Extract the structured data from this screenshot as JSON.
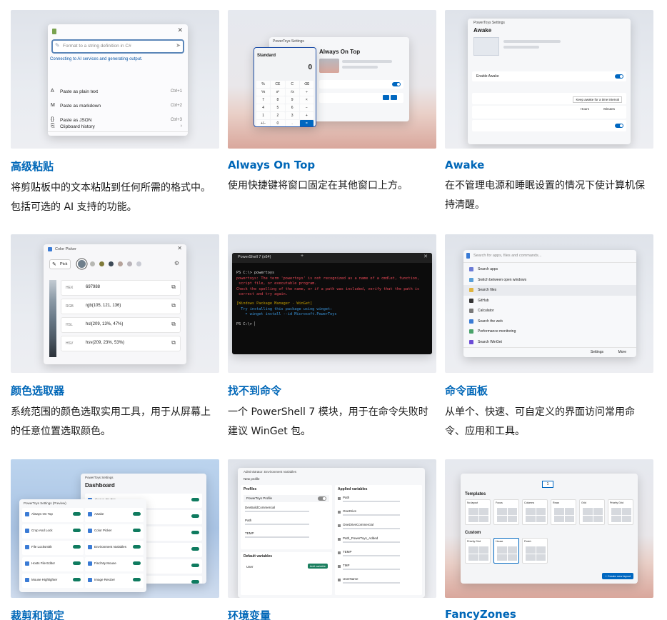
{
  "cards": [
    {
      "title": "高级粘贴",
      "desc": "将剪贴板中的文本粘贴到任何所需的格式中。 包括可选的 AI 支持的功能。",
      "mock": {
        "placeholder": "Format to a string definition in C#",
        "status": "Connecting to AI services and generating output.",
        "items": [
          {
            "label": "Paste as plain text",
            "shortcut": "Ctrl+1"
          },
          {
            "label": "Paste as markdown",
            "shortcut": "Ctrl+2"
          },
          {
            "label": "Paste as JSON",
            "shortcut": "Ctrl+3"
          }
        ],
        "history": "Clipboard history"
      }
    },
    {
      "title": "Always On Top",
      "desc": "使用快捷键将窗口固定在其他窗口上方。",
      "mock": {
        "calc_title": "Standard",
        "calc_display": "0",
        "keys": [
          "%",
          "CE",
          "C",
          "⌫",
          "⅟x",
          "x²",
          "√x",
          "÷",
          "7",
          "8",
          "9",
          "×",
          "4",
          "5",
          "6",
          "−",
          "1",
          "2",
          "3",
          "+",
          "+/−",
          "0",
          ".",
          "="
        ],
        "panel_title": "Always On Top",
        "settings_title": "PowerToys Settings"
      }
    },
    {
      "title": "Awake",
      "desc": "在不管理电源和睡眠设置的情况下使计算机保持清醒。",
      "mock": {
        "settings_title": "PowerToys Settings",
        "heading": "Awake",
        "enable_label": "Enable Awake",
        "mode_value": "Keep awake for a time interval",
        "hours_label": "Hours",
        "minutes_label": "Minutes"
      }
    },
    {
      "title": "颜色选取器",
      "desc": "系统范围的颜色选取实用工具，用于从屏幕上的任意位置选取颜色。",
      "mock": {
        "window_title": "Color Picker",
        "pick_label": "Pick",
        "swatches": [
          "#6f7f8c",
          "#b7b8b3",
          "#7f7a3a",
          "#3d4a57",
          "#b6a39b",
          "#b9b4ba",
          "#c9cbd4"
        ],
        "formats": [
          {
            "name": "HEX",
            "value": "697988"
          },
          {
            "name": "RGB",
            "value": "rgb(105, 121, 136)"
          },
          {
            "name": "HSL",
            "value": "hsl(209, 13%, 47%)"
          },
          {
            "name": "HSV",
            "value": "hsv(209, 23%, 53%)"
          }
        ]
      }
    },
    {
      "title": "找不到命令",
      "desc": "一个 PowerShell 7 模块，用于在命令失败时建议 WinGet 包。",
      "mock": {
        "tab_title": "PowerShell 7 (x64)",
        "prompt_line": "PS C:\\> powertoys",
        "error_lines": [
          "powertoys: The term 'powertoys' is not recognized as a name of a cmdlet, function,",
          " script file, or executable program.",
          "Check the spelling of the name, or if a path was included, verify that the path is",
          " correct and try again."
        ],
        "feedback_title": "[Windows Package Manager - WinGet]",
        "feedback_lines": [
          "  Try installing this package using winget:",
          "    ➤ winget install --id Microsoft.PowerToys"
        ],
        "last_prompt": "PS C:\\> "
      }
    },
    {
      "title": "命令面板",
      "desc": "从单个、快速、可自定义的界面访问常用命令、应用和工具。",
      "mock": {
        "search_placeholder": "Search for apps, files and commands...",
        "items": [
          "Search apps",
          "Switch between open windows",
          "Search files",
          "GitHub",
          "Calculator",
          "Search the web",
          "Performance monitoring",
          "Search WinGet"
        ],
        "footer_settings": "Settings",
        "footer_more": "More"
      }
    },
    {
      "title": "裁剪和锁定",
      "desc": "",
      "mock": {
        "front_title": "PowerToys Settings (Preview)",
        "back_title": "PowerToys Settings",
        "dashboard": "Dashboard",
        "left_items": [
          "Always On Top",
          "Crop And Lock",
          "File Locksmith",
          "Hosts File Editor",
          "Mouse Highlighter"
        ],
        "right_items": [
          "Awake",
          "Color Picker",
          "Environment Variables",
          "Find My Mouse",
          "Image Resizer"
        ],
        "back_items": [
          "Always On Top",
          "Awake",
          "Color Picker",
          "Environment Variables",
          "Find My Mouse",
          "Image Resizer"
        ]
      }
    },
    {
      "title": "环境变量",
      "desc": "",
      "mock": {
        "window_title": "Administrator: Environment Variables",
        "new_profile": "New profile",
        "profiles_label": "Profiles",
        "profile_name": "PowerToys Profile",
        "applied_label": "Applied variables",
        "default_label": "Default variables",
        "user_label": "User",
        "add_label": "Add variable",
        "left_vars": [
          "DevBuildCommercial",
          "Path",
          "TEMP"
        ],
        "right_vars": [
          "Path",
          "OneDrive",
          "OneDriveCommercial",
          "Path_PowerToys_Added",
          "TEMP",
          "TMP",
          "UserName"
        ]
      }
    },
    {
      "title": "FancyZones",
      "desc": "",
      "mock": {
        "monitor": "1",
        "templates_label": "Templates",
        "templates": [
          "No layout",
          "Focus",
          "Columns",
          "Rows",
          "Grid",
          "Priority Grid"
        ],
        "custom_label": "Custom",
        "custom": [
          "Priority Grid",
          "House",
          "Finish"
        ],
        "create_button": "+ Create new layout"
      }
    }
  ]
}
